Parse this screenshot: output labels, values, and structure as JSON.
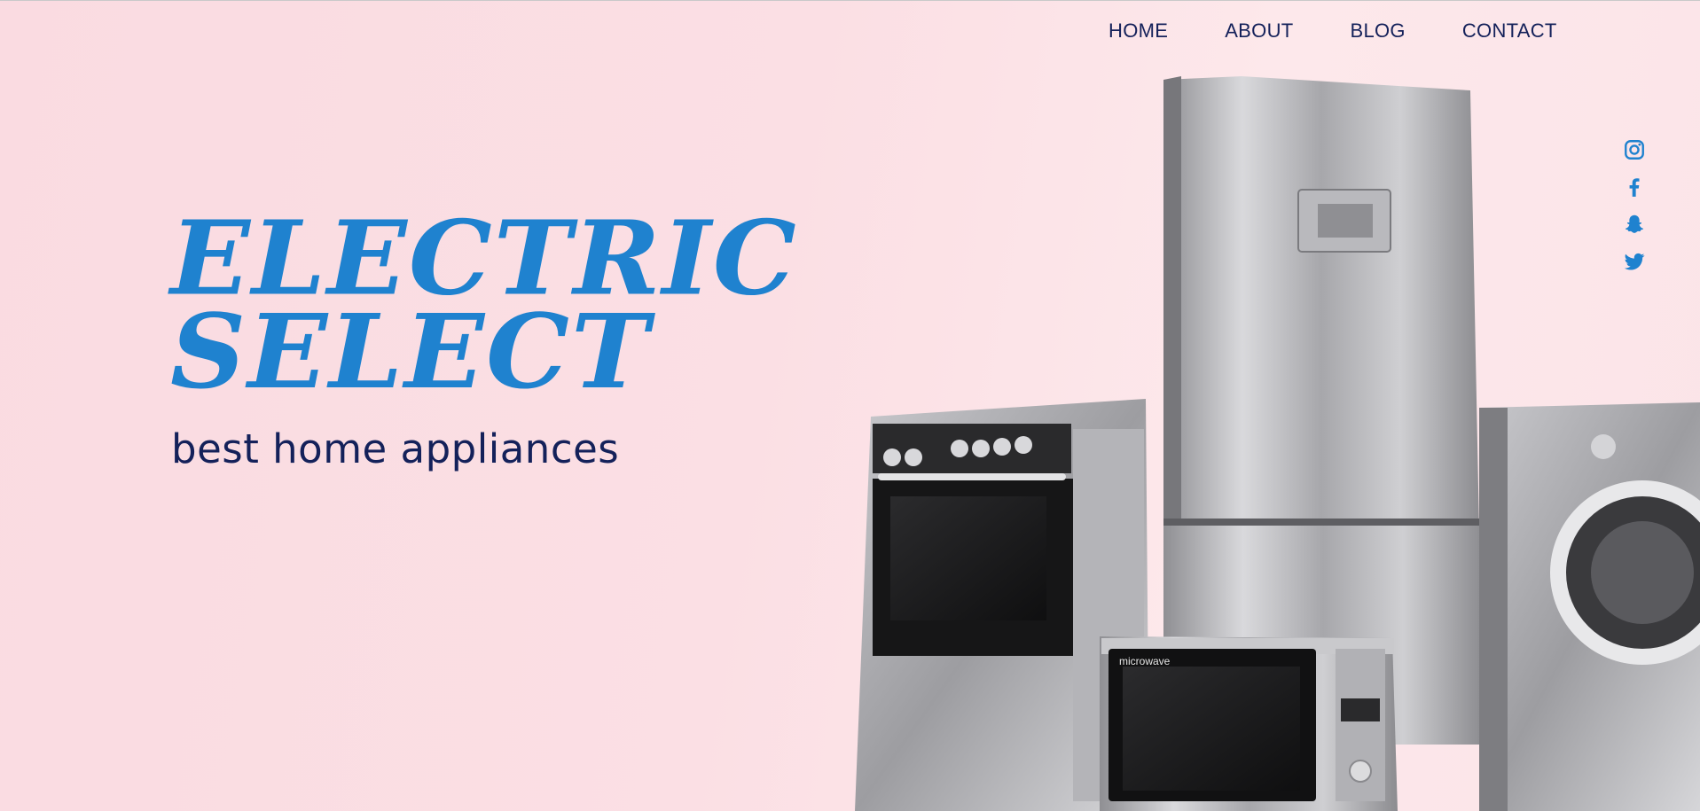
{
  "nav": {
    "items": [
      {
        "label": "HOME"
      },
      {
        "label": "ABOUT"
      },
      {
        "label": "BLOG"
      },
      {
        "label": "CONTACT"
      }
    ]
  },
  "hero": {
    "title_line1": "ELECTRIC",
    "title_line2": "SELECT",
    "subtitle": "best home appliances"
  },
  "social": [
    {
      "name": "instagram-icon"
    },
    {
      "name": "facebook-icon"
    },
    {
      "name": "snapchat-icon"
    },
    {
      "name": "twitter-icon"
    }
  ],
  "appliances": {
    "microwave_label": "microwave"
  },
  "colors": {
    "accent": "#1f82cf",
    "nav_text": "#14215a",
    "background": "#fadbe1"
  }
}
